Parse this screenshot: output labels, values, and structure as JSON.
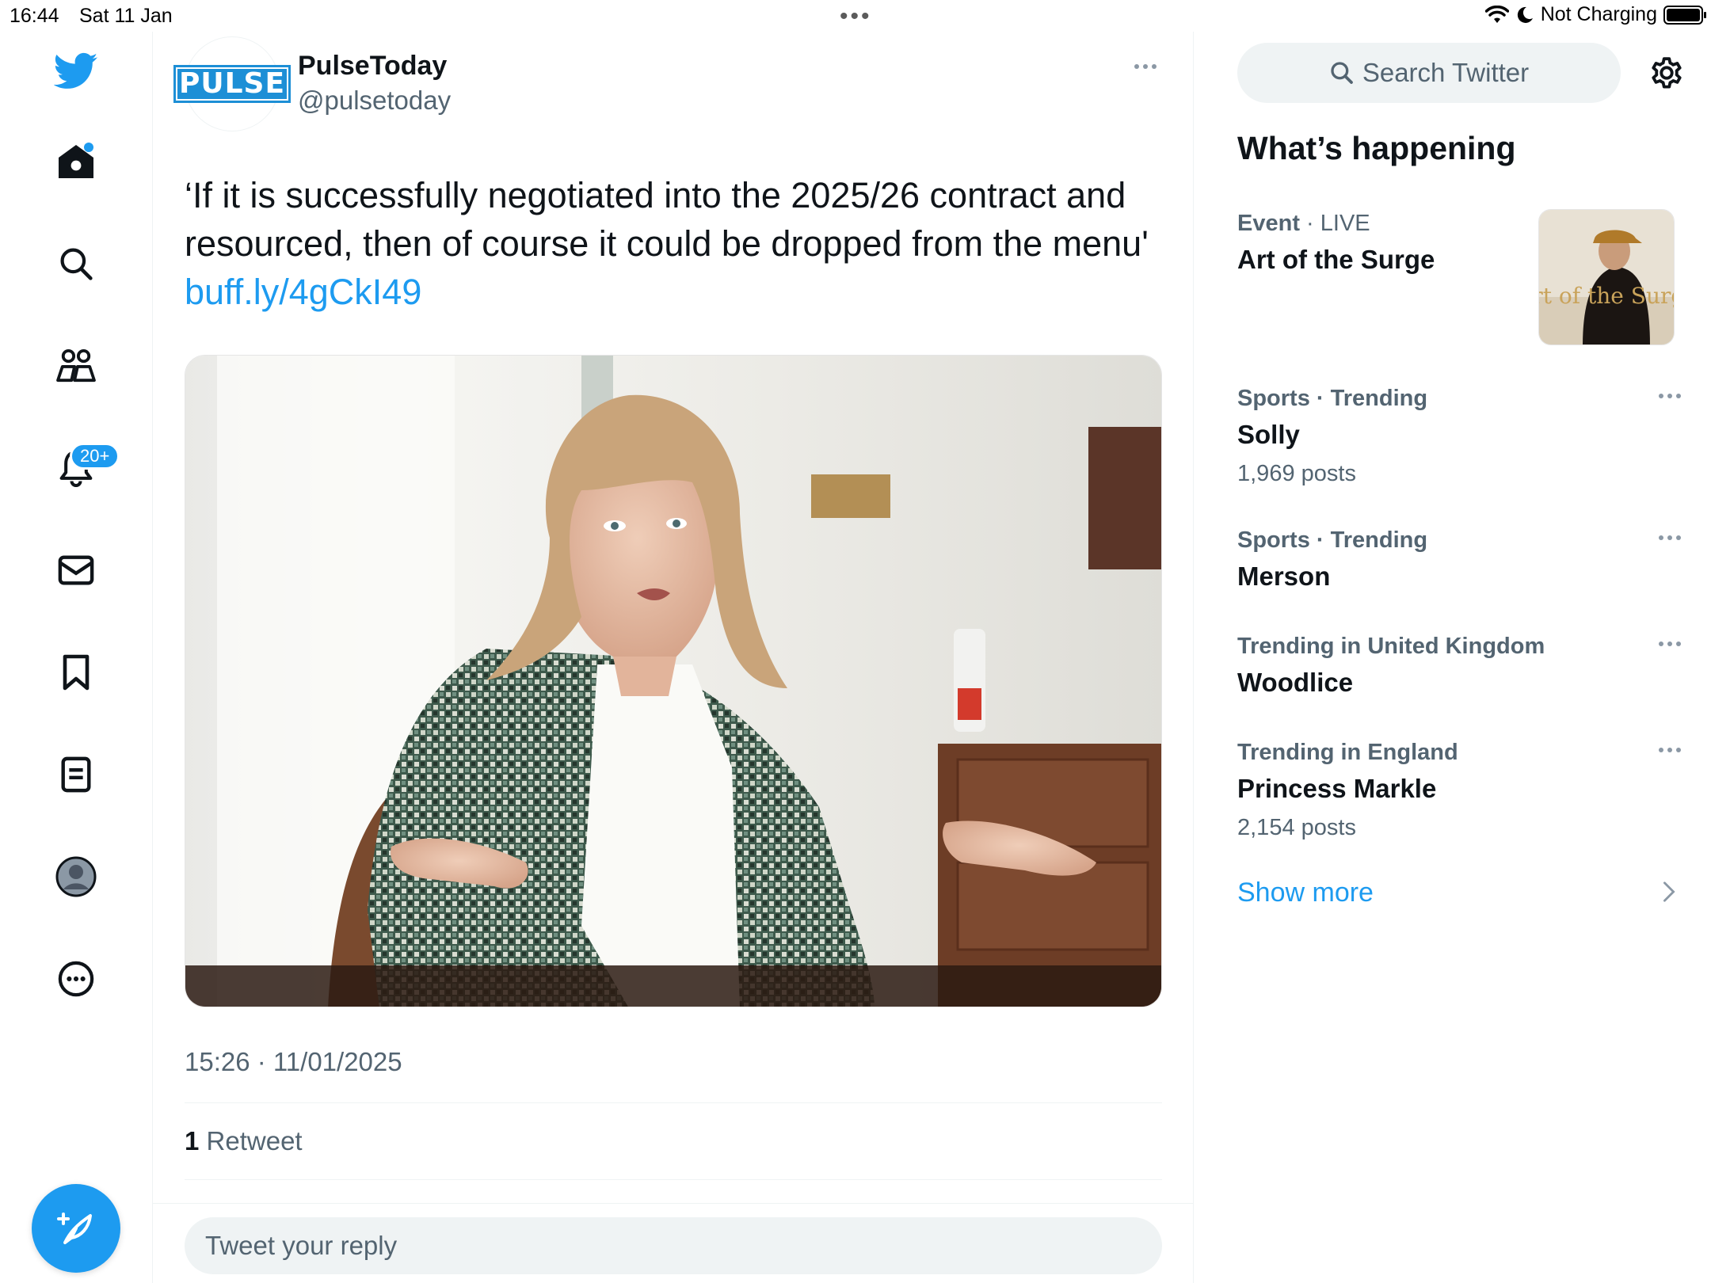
{
  "status_bar": {
    "time": "16:44",
    "date": "Sat 11 Jan",
    "charging": "Not Charging"
  },
  "nav": {
    "notifications_badge": "20+",
    "items": [
      "twitter-logo-icon",
      "home-icon",
      "explore-icon",
      "communities-icon",
      "notifications-icon",
      "messages-icon",
      "bookmarks-icon",
      "lists-icon",
      "profile-icon",
      "more-icon"
    ]
  },
  "tweet": {
    "author_name": "PulseToday",
    "author_handle": "@pulsetoday",
    "avatar_text": "PULSE",
    "text": "‘If it is successfully negotiated into the 2025/26 contract and resourced, then of course it could be dropped from the menu' ",
    "link": "buff.ly/4gCkI49",
    "timestamp": "15:26 · 11/01/2025",
    "retweet_count": "1",
    "retweet_label": " Retweet",
    "reply_placeholder": "Tweet your reply"
  },
  "sidebar": {
    "search_placeholder": "Search Twitter",
    "section_title": "What’s happening",
    "event": {
      "category": "Event",
      "live": " · LIVE",
      "title": "Art of the Surge",
      "thumb_text": "Art of the Surge"
    },
    "trends": [
      {
        "context": "Sports · Trending",
        "title": "Solly",
        "count": "1,969 posts"
      },
      {
        "context": "Sports · Trending",
        "title": "Merson",
        "count": ""
      },
      {
        "context": "Trending in United Kingdom",
        "title": "Woodlice",
        "count": ""
      },
      {
        "context": "Trending in England",
        "title": "Princess Markle",
        "count": "2,154 posts"
      }
    ],
    "show_more": "Show more"
  },
  "colors": {
    "accent": "#1d9bf0",
    "text_primary": "#0f1419",
    "text_secondary": "#536471",
    "divider": "#eff3f4"
  }
}
